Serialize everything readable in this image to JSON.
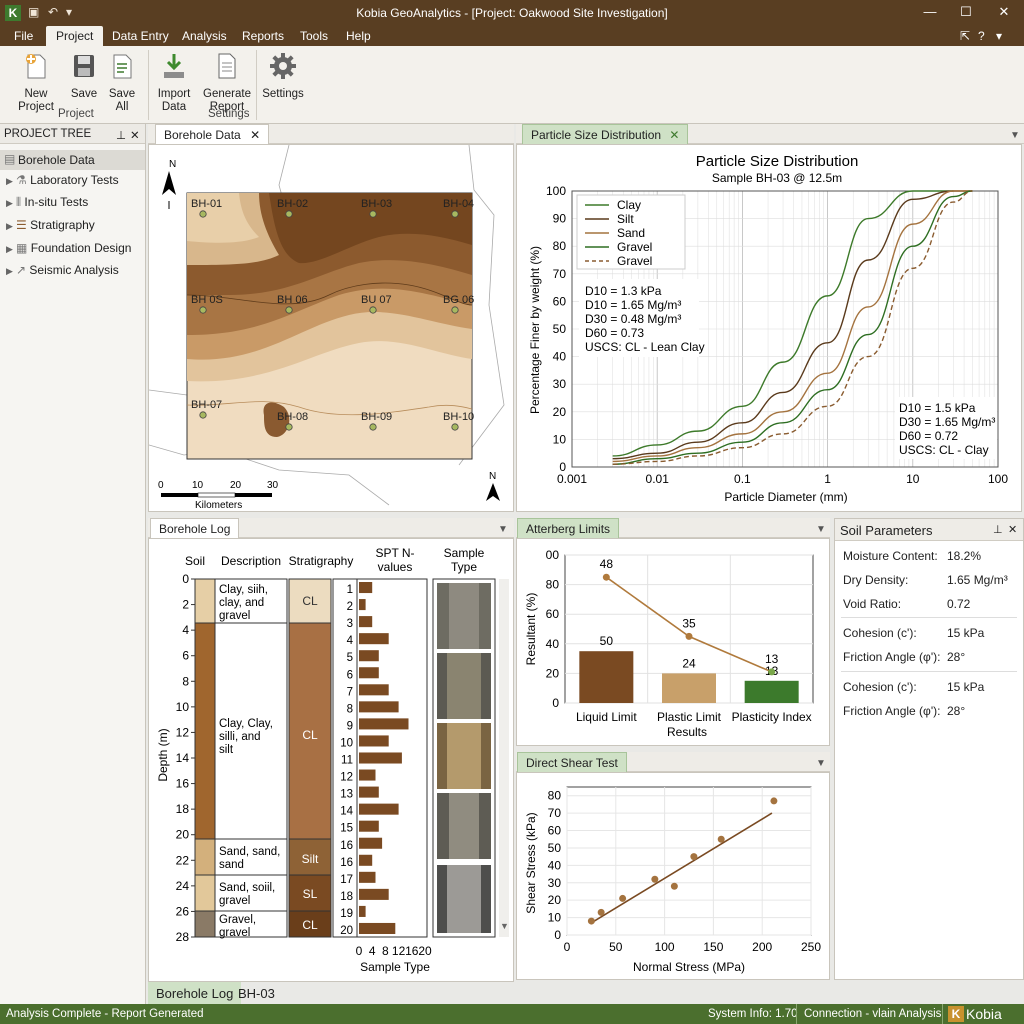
{
  "app": {
    "title": "Kobia GeoAnalytics - [Project: Oakwood Site Investigation]",
    "logo_letter": "K",
    "win_min": "—",
    "win_max": "☐",
    "win_close": "✕"
  },
  "menu": [
    "File",
    "Project",
    "Data Entry",
    "Analysis",
    "Reports",
    "Tools",
    "Help"
  ],
  "ribbon": {
    "new_project": "New Project",
    "save": "Save",
    "save_all": "Save All",
    "group_project": "Project",
    "import_data": [
      "Import",
      "Data"
    ],
    "generate_report": [
      "Generate",
      "Report"
    ],
    "group_settings": "Settings",
    "settings": "Settings"
  },
  "tree": {
    "header": "PROJECT TREE",
    "items": [
      "Borehole Data",
      "Laboratory Tests",
      "In-situ Tests",
      "Stratigraphy",
      "Foundation Design",
      "Seismic Analysis"
    ]
  },
  "map_panel": {
    "tab": "Borehole Data",
    "north": "N",
    "north_right": "N",
    "boreholes": [
      "BH-01",
      "BH-02",
      "BH-03",
      "BH-04",
      "BH-0S",
      "BH-06",
      "BH-07",
      "BH-08",
      "BH-09",
      "BH-10"
    ],
    "bh_mid": [
      "BH 0S",
      "BH 06",
      "BU 07",
      "BG 06"
    ],
    "scale_ticks": [
      "0",
      "10",
      "20",
      "30"
    ],
    "scale_label": "Kilometers"
  },
  "psd_panel": {
    "tab": "Particle Size Distribution",
    "title": "Particle Size Distribution",
    "subtitle": "Sample BH-03 @ 12.5m",
    "ylabel": "Percentage Finer by weight (%)",
    "xlabel": "Particle Diameter (mm)",
    "legend": [
      "Clay",
      "Silt",
      "Sand",
      "Gravel",
      "Gravel"
    ],
    "info_left": [
      "D10 = 1.3 kPa",
      "D10 = 1.65 Mg/m³",
      "D30 = 0.48 Mg/m³",
      "D60 = 0.73",
      "USCS: CL - Lean Clay"
    ],
    "info_right": [
      "D10 = 1.5 kPa",
      "D30 = 1.65 Mg/m³",
      "D60 = 0.72",
      "USCS: CL - Clay"
    ]
  },
  "borehole_log": {
    "tab": "Borehole Log",
    "col_soil": "Soil",
    "col_desc": "Description",
    "col_strat": "Stratigraphy",
    "col_spt": [
      "SPT N-",
      "values"
    ],
    "col_sample": [
      "Sample",
      "Type"
    ],
    "depth_label": "Depth (m)",
    "depth_ticks": [
      "0",
      "2",
      "4",
      "6",
      "8",
      "10",
      "12",
      "14",
      "16",
      "18",
      "20",
      "22",
      "24",
      "26",
      "28"
    ],
    "layers": [
      {
        "desc": [
          "Clay, siih,",
          "clay, and",
          "gravel"
        ],
        "strat": "CL"
      },
      {
        "desc": [
          "Clay, Clay,",
          "silli, and",
          "silt"
        ],
        "strat": "CL"
      },
      {
        "desc": [
          "Sand, sand,",
          "sand"
        ],
        "strat": "Silt"
      },
      {
        "desc": [
          "Sand, soiil,",
          "gravel"
        ],
        "strat": "SL"
      },
      {
        "desc": [
          "Gravel,",
          "gravel"
        ],
        "strat": "CL"
      }
    ],
    "spt_index": [
      "1",
      "2",
      "3",
      "4",
      "5",
      "6",
      "7",
      "8",
      "9",
      "10",
      "11",
      "12",
      "13",
      "14",
      "15",
      "16",
      "16",
      "17",
      "18",
      "19",
      "20"
    ],
    "spt_ticks": [
      "0",
      "4",
      "8",
      "12",
      "16",
      "20"
    ],
    "spt_xlabel": "Sample Type",
    "bottom_tab": "Borehole Log",
    "bottom_id": "BH-03"
  },
  "atterberg": {
    "tab": "Atterberg Limits",
    "ylabel": "Resultant (%)",
    "xlabel_results": "Results",
    "categories": [
      "Liquid Limit",
      "Plastic Limit",
      "Plasticity Index"
    ],
    "yticks": [
      "00",
      "80",
      "60",
      "40",
      "20",
      "0"
    ]
  },
  "direct_shear": {
    "tab": "Direct Shear Test",
    "ylabel": "Shear Stress (kPa)",
    "xlabel": "Normal Stress (MPa)",
    "yticks": [
      "80",
      "70",
      "60",
      "50",
      "40",
      "30",
      "20",
      "10",
      "0"
    ],
    "xticks": [
      "0",
      "50",
      "100",
      "150",
      "200",
      "250"
    ]
  },
  "soil_params": {
    "title": "Soil Parameters",
    "rows": [
      {
        "label": "Moisture Content:",
        "value": "18.2%"
      },
      {
        "label": "Dry Density:",
        "value": "1.65 Mg/m³"
      },
      {
        "label": "Void Ratio:",
        "value": "0.72"
      },
      {
        "label": "Cohesion (c'):",
        "value": "15 kPa"
      },
      {
        "label": "Friction Angle (φ'):",
        "value": "28°"
      },
      {
        "label": "Cohesion (c'):",
        "value": "15 kPa"
      },
      {
        "label": "Friction Angle (φ'):",
        "value": "28°"
      }
    ]
  },
  "status": {
    "left": "Analysis Complete - Report Generated",
    "system": "System Info: 1.70",
    "connection": "Connection - vlain Analysis",
    "brand": "Kobia"
  },
  "chart_data": [
    {
      "type": "line",
      "title": "Particle Size Distribution",
      "subtitle": "Sample BH-03 @ 12.5m",
      "xlabel": "Particle Diameter (mm)",
      "ylabel": "Percentage Finer by weight (%)",
      "x_scale": "log",
      "xlim": [
        0.001,
        100
      ],
      "ylim": [
        0,
        100
      ],
      "xticks": [
        "0.001",
        "0.01",
        "0.1",
        "1",
        "10",
        "100"
      ],
      "yticks": [
        "0",
        "10",
        "20",
        "30",
        "40",
        "50",
        "60",
        "70",
        "80",
        "90",
        "100"
      ],
      "grid": true,
      "legend_position": "top-left",
      "series": [
        {
          "name": "Clay",
          "color": "#3d7a2a",
          "style": "solid",
          "x": [
            0.003,
            0.01,
            0.03,
            0.1,
            0.3,
            1,
            3,
            10,
            30
          ],
          "y": [
            4,
            8,
            13,
            22,
            38,
            62,
            90,
            100,
            100
          ]
        },
        {
          "name": "Silt",
          "color": "#5a3a1c",
          "style": "solid",
          "x": [
            0.003,
            0.01,
            0.03,
            0.1,
            0.3,
            1,
            3,
            10,
            30,
            50
          ],
          "y": [
            3,
            5,
            9,
            16,
            27,
            45,
            75,
            97,
            100,
            100
          ]
        },
        {
          "name": "Sand",
          "color": "#a4733f",
          "style": "solid",
          "x": [
            0.003,
            0.01,
            0.03,
            0.1,
            0.3,
            1,
            3,
            10,
            30,
            50
          ],
          "y": [
            2,
            4,
            7,
            12,
            20,
            34,
            58,
            88,
            100,
            100
          ]
        },
        {
          "name": "Gravel",
          "color": "#2e6e22",
          "style": "solid",
          "x": [
            0.003,
            0.01,
            0.03,
            0.1,
            0.3,
            1,
            3,
            10,
            30,
            50
          ],
          "y": [
            1,
            3,
            5,
            9,
            16,
            28,
            48,
            80,
            98,
            100
          ]
        },
        {
          "name": "Gravel",
          "color": "#8a5c30",
          "style": "dashed",
          "x": [
            0.003,
            0.01,
            0.03,
            0.1,
            0.3,
            1,
            3,
            10,
            30,
            50
          ],
          "y": [
            1,
            2,
            4,
            7,
            12,
            22,
            40,
            72,
            96,
            100
          ]
        }
      ]
    },
    {
      "type": "bar",
      "xlabel": "Results",
      "ylabel": "Resultant (%)",
      "ylim": [
        0,
        100
      ],
      "categories": [
        "Liquid Limit",
        "Plastic Limit",
        "Plasticity Index"
      ],
      "values": [
        35,
        20,
        15
      ],
      "data_labels": [
        "50",
        "24",
        "13"
      ],
      "bar_colors": [
        "#7a4a22",
        "#c8a06a",
        "#3c7a2c"
      ],
      "overlay_line": {
        "values": [
          85,
          45,
          21
        ],
        "labels": [
          "48",
          "35",
          "13"
        ],
        "color": "#b07a3c"
      }
    },
    {
      "type": "scatter",
      "xlabel": "Normal Stress (MPa)",
      "ylabel": "Shear Stress (kPa)",
      "xlim": [
        0,
        250
      ],
      "ylim": [
        0,
        85
      ],
      "points": [
        [
          25,
          8
        ],
        [
          35,
          13
        ],
        [
          57,
          21
        ],
        [
          90,
          32
        ],
        [
          110,
          28
        ],
        [
          130,
          45
        ],
        [
          158,
          55
        ],
        [
          212,
          77
        ]
      ],
      "fit_line": [
        [
          25,
          7
        ],
        [
          210,
          70
        ]
      ]
    },
    {
      "type": "bar",
      "orientation": "horizontal",
      "xlabel": "Sample Type",
      "xlim": [
        0,
        20
      ],
      "categories": [
        "1",
        "2",
        "3",
        "4",
        "5",
        "6",
        "7",
        "8",
        "9",
        "10",
        "11",
        "12",
        "13",
        "14",
        "15",
        "16",
        "16",
        "17",
        "18",
        "19",
        "20"
      ],
      "values": [
        4,
        2,
        4,
        9,
        6,
        6,
        9,
        12,
        15,
        9,
        13,
        5,
        6,
        12,
        6,
        7,
        4,
        5,
        9,
        2,
        11
      ]
    }
  ]
}
